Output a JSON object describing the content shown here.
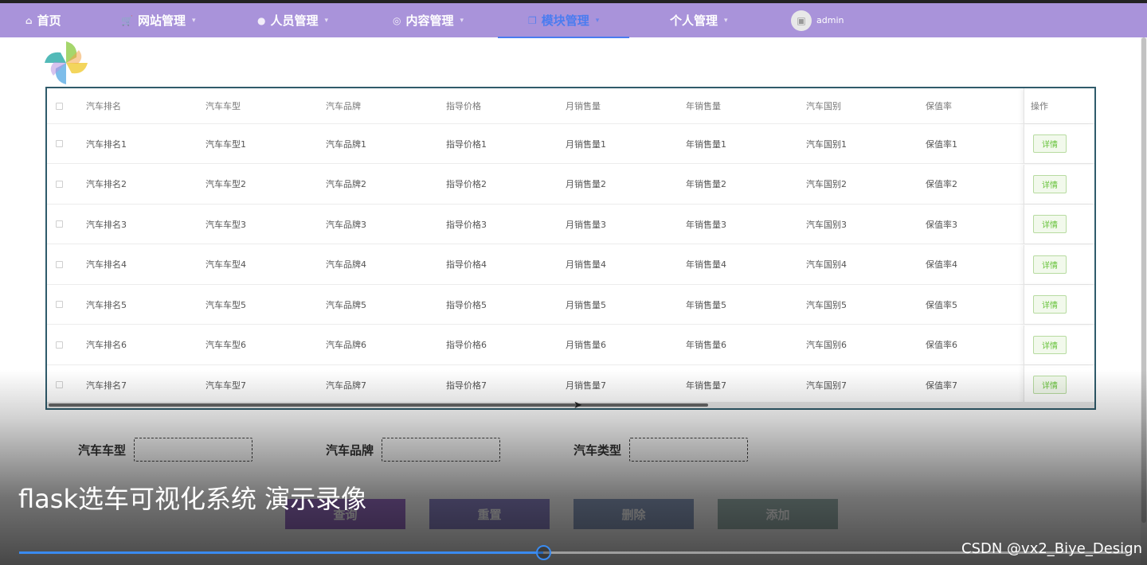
{
  "nav": {
    "items": [
      {
        "label": "首页",
        "icon": "home-icon",
        "glyph": "⌂",
        "caret": false,
        "active": false
      },
      {
        "label": "网站管理",
        "icon": "cart-icon",
        "glyph": "🛒",
        "caret": true,
        "active": false
      },
      {
        "label": "人员管理",
        "icon": "user-icon",
        "glyph": "●",
        "caret": true,
        "active": false
      },
      {
        "label": "内容管理",
        "icon": "at-icon",
        "glyph": "◎",
        "caret": true,
        "active": false
      },
      {
        "label": "模块管理",
        "icon": "copy-icon",
        "glyph": "❐",
        "caret": true,
        "active": true
      },
      {
        "label": "个人管理",
        "icon": "",
        "glyph": "",
        "caret": true,
        "active": false
      }
    ],
    "user": {
      "name": "admin",
      "icon": "image-avatar-icon"
    },
    "accent": "#a993da",
    "active_color": "#4a7cf0"
  },
  "logo": {
    "icon": "pinwheel-logo-icon"
  },
  "table": {
    "headers": [
      "汽车排名",
      "汽车车型",
      "汽车品牌",
      "指导价格",
      "月销售量",
      "年销售量",
      "汽车国别",
      "保值率"
    ],
    "op_header": "操作",
    "rows": [
      [
        "汽车排名1",
        "汽车车型1",
        "汽车品牌1",
        "指导价格1",
        "月销售量1",
        "年销售量1",
        "汽车国别1",
        "保值率1"
      ],
      [
        "汽车排名2",
        "汽车车型2",
        "汽车品牌2",
        "指导价格2",
        "月销售量2",
        "年销售量2",
        "汽车国别2",
        "保值率2"
      ],
      [
        "汽车排名3",
        "汽车车型3",
        "汽车品牌3",
        "指导价格3",
        "月销售量3",
        "年销售量3",
        "汽车国别3",
        "保值率3"
      ],
      [
        "汽车排名4",
        "汽车车型4",
        "汽车品牌4",
        "指导价格4",
        "月销售量4",
        "年销售量4",
        "汽车国别4",
        "保值率4"
      ],
      [
        "汽车排名5",
        "汽车车型5",
        "汽车品牌5",
        "指导价格5",
        "月销售量5",
        "年销售量5",
        "汽车国别5",
        "保值率5"
      ],
      [
        "汽车排名6",
        "汽车车型6",
        "汽车品牌6",
        "指导价格6",
        "月销售量6",
        "年销售量6",
        "汽车国别6",
        "保值率6"
      ],
      [
        "汽车排名7",
        "汽车车型7",
        "汽车品牌7",
        "指导价格7",
        "月销售量7",
        "年销售量7",
        "汽车国别7",
        "保值率7"
      ]
    ],
    "row_button": "详情"
  },
  "form": {
    "fields": [
      {
        "label": "汽车车型",
        "value": ""
      },
      {
        "label": "汽车品牌",
        "value": ""
      },
      {
        "label": "汽车类型",
        "value": ""
      }
    ],
    "buttons": {
      "query": "查询",
      "reset": "重置",
      "delete": "删除",
      "add": "添加"
    }
  },
  "video": {
    "title": "flask选车可视化系统 演示录像",
    "progress": 0.473,
    "watermark": "CSDN @vx2_Biye_Design"
  }
}
